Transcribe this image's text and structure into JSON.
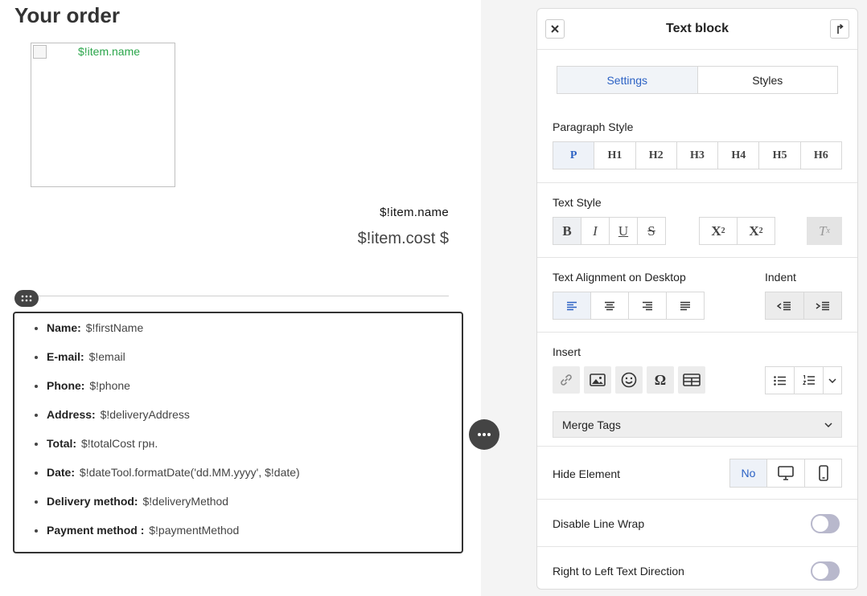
{
  "canvas": {
    "title": "Your order",
    "image_alt": "$!item.name",
    "item_name": "$!item.name",
    "item_cost": "$!item.cost $",
    "fields": [
      {
        "label": "Name:",
        "value": "$!firstName"
      },
      {
        "label": "E-mail:",
        "value": "$!email"
      },
      {
        "label": "Phone:",
        "value": "$!phone"
      },
      {
        "label": "Address:",
        "value": "$!deliveryAddress"
      },
      {
        "label": "Total:",
        "value": "$!totalCost грн."
      },
      {
        "label": "Date:",
        "value": "$!dateTool.formatDate('dd.MM.yyyy', $!date)"
      },
      {
        "label": "Delivery method:",
        "value": "$!deliveryMethod"
      },
      {
        "label": "Payment  method :",
        "value": "$!paymentMethod"
      }
    ]
  },
  "panel": {
    "title": "Text block",
    "tabs": [
      "Settings",
      "Styles"
    ],
    "paragraph_style": {
      "label": "Paragraph Style",
      "options": [
        "P",
        "H1",
        "H2",
        "H3",
        "H4",
        "H5",
        "H6"
      ],
      "selected": "P"
    },
    "text_style": {
      "label": "Text Style",
      "buttons": [
        "B",
        "I",
        "U",
        "S"
      ],
      "sub_base": "X",
      "sub_mark": "2",
      "sup_base": "X",
      "sup_mark": "2",
      "clear_base": "T",
      "clear_mark": "x"
    },
    "alignment": {
      "label": "Text Alignment on Desktop",
      "selected": "left",
      "options": [
        "align-left-icon",
        "align-center-icon",
        "align-right-icon",
        "align-justify-icon"
      ]
    },
    "indent": {
      "label": "Indent"
    },
    "insert": {
      "label": "Insert",
      "buttons": [
        "link-icon",
        "image-icon",
        "emoji-icon",
        "omega-icon",
        "table-icon"
      ],
      "list_buttons": [
        "bullet-list-icon",
        "numbered-list-icon",
        "chevron-down-icon"
      ],
      "merge_tags": "Merge Tags",
      "omega_glyph": "Ω"
    },
    "hide_element": {
      "label": "Hide Element",
      "no_label": "No"
    },
    "disable_line_wrap": {
      "label": "Disable Line Wrap",
      "on": false
    },
    "rtl": {
      "label": "Right to Left Text Direction",
      "on": false
    }
  },
  "colors": {
    "accent": "#2c62c4",
    "alt_text": "#2aa54a",
    "dark_button": "#444444"
  }
}
